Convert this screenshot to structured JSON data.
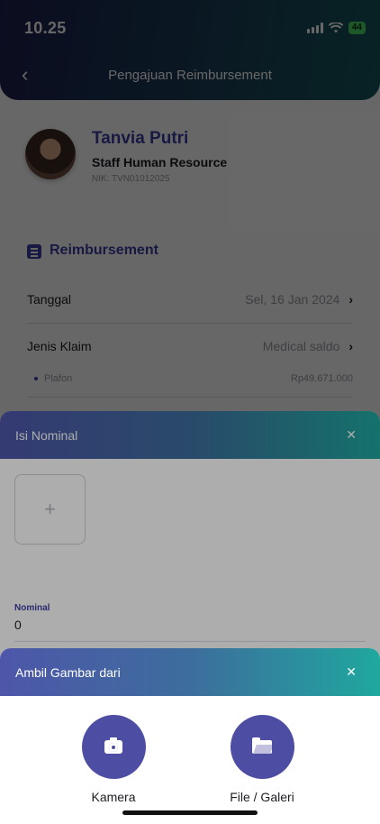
{
  "status_bar": {
    "time": "10.25",
    "battery": "44"
  },
  "header": {
    "title": "Pengajuan Reimbursement"
  },
  "profile": {
    "name": "Tanvia Putri",
    "role": "Staff Human Resource",
    "nik": "NIK: TVN01012025"
  },
  "reimbursement": {
    "section_title": "Reimbursement",
    "tanggal": {
      "label": "Tanggal",
      "value": "Sel, 16 Jan 2024"
    },
    "jenis_klaim": {
      "label": "Jenis Klaim",
      "value": "Medical saldo"
    },
    "plafon": {
      "label": "Plafon",
      "value": "Rp49.671.000"
    }
  },
  "sheet_nominal": {
    "title": "Isi Nominal",
    "upload_symbol": "+",
    "nominal_label": "Nominal",
    "nominal_value": "0"
  },
  "sheet_image_source": {
    "title": "Ambil Gambar dari",
    "options": [
      {
        "label": "Kamera",
        "icon": "camera-icon"
      },
      {
        "label": "File / Galeri",
        "icon": "folder-icon"
      }
    ]
  },
  "colors": {
    "primary": "#3d3fa6",
    "header_dark": "#1e2150",
    "accent_teal": "#1fa89e",
    "option_circle": "#4d4ea3"
  }
}
